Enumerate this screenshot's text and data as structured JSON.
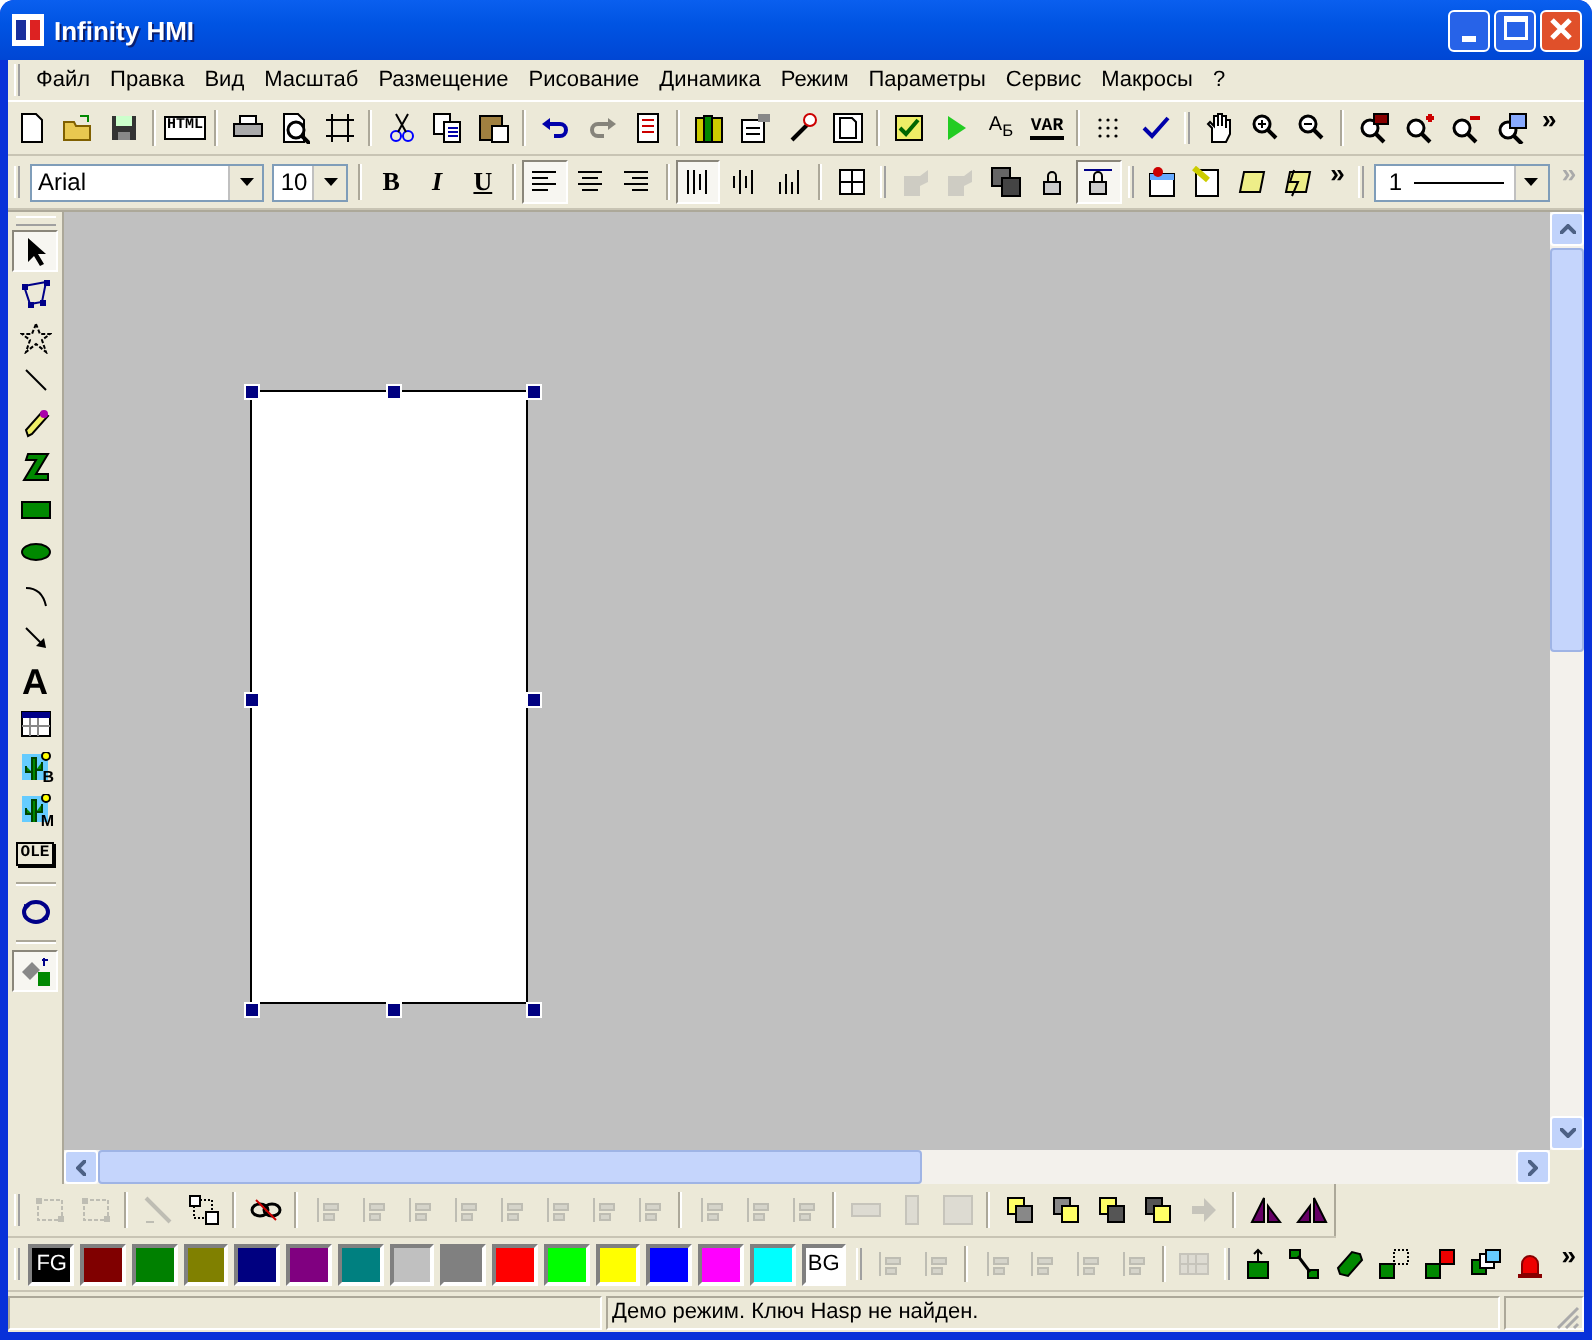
{
  "window": {
    "title": "Infinity HMI"
  },
  "menu": [
    {
      "label": "Файл"
    },
    {
      "label": "Правка"
    },
    {
      "label": "Вид"
    },
    {
      "label": "Масштаб"
    },
    {
      "label": "Размещение"
    },
    {
      "label": "Рисование"
    },
    {
      "label": "Динамика"
    },
    {
      "label": "Режим"
    },
    {
      "label": "Параметры"
    },
    {
      "label": "Сервис"
    },
    {
      "label": "Макросы"
    },
    {
      "label": "?"
    }
  ],
  "toolbar_main": [
    {
      "kind": "button",
      "disabled": false
    },
    {
      "kind": "button",
      "disabled": false
    },
    {
      "kind": "button",
      "disabled": false
    },
    {
      "kind": "separator"
    },
    {
      "kind": "button",
      "disabled": false,
      "label": "HTML"
    },
    {
      "kind": "separator"
    },
    {
      "kind": "button",
      "disabled": false
    },
    {
      "kind": "button",
      "disabled": false
    },
    {
      "kind": "button",
      "disabled": false
    },
    {
      "kind": "separator"
    },
    {
      "kind": "button",
      "disabled": false
    },
    {
      "kind": "button",
      "disabled": false
    },
    {
      "kind": "button",
      "disabled": false
    },
    {
      "kind": "separator"
    },
    {
      "kind": "button",
      "disabled": false
    },
    {
      "kind": "button",
      "disabled": true
    },
    {
      "kind": "button",
      "disabled": false
    },
    {
      "kind": "separator"
    },
    {
      "kind": "button",
      "disabled": false
    },
    {
      "kind": "button",
      "disabled": false
    },
    {
      "kind": "button",
      "disabled": false
    },
    {
      "kind": "button",
      "disabled": false
    },
    {
      "kind": "separator"
    },
    {
      "kind": "button",
      "disabled": false
    },
    {
      "kind": "button",
      "disabled": false
    },
    {
      "kind": "button",
      "disabled": false,
      "label": "A$_{Б}$"
    },
    {
      "kind": "button",
      "disabled": false,
      "label": "VAR"
    },
    {
      "kind": "separator"
    },
    {
      "kind": "button",
      "disabled": false
    },
    {
      "kind": "button",
      "disabled": false
    },
    {
      "kind": "grip"
    },
    {
      "kind": "button",
      "disabled": false
    },
    {
      "kind": "button",
      "disabled": false
    },
    {
      "kind": "button",
      "disabled": false
    },
    {
      "kind": "separator"
    },
    {
      "kind": "button",
      "disabled": false
    },
    {
      "kind": "button",
      "disabled": false
    },
    {
      "kind": "button",
      "disabled": false
    },
    {
      "kind": "button",
      "disabled": false
    },
    {
      "kind": "chevron",
      "label": "»"
    }
  ],
  "toolbar_format": [
    {
      "kind": "combo",
      "value": "Arial"
    },
    {
      "kind": "combo",
      "value": "10"
    },
    {
      "kind": "separator"
    },
    {
      "kind": "button",
      "disabled": false,
      "selected": false,
      "label": "B"
    },
    {
      "kind": "button",
      "disabled": false,
      "selected": false,
      "label": "I"
    },
    {
      "kind": "button",
      "disabled": false,
      "selected": false,
      "label": "U"
    },
    {
      "kind": "separator"
    },
    {
      "kind": "button",
      "disabled": false,
      "selected": true
    },
    {
      "kind": "button",
      "disabled": false,
      "selected": false
    },
    {
      "kind": "button",
      "disabled": false,
      "selected": false
    },
    {
      "kind": "separator"
    },
    {
      "kind": "button",
      "disabled": false,
      "selected": true
    },
    {
      "kind": "button",
      "disabled": false,
      "selected": false
    },
    {
      "kind": "button",
      "disabled": false,
      "selected": false
    },
    {
      "kind": "separator"
    },
    {
      "kind": "button",
      "disabled": false,
      "selected": false
    },
    {
      "kind": "grip"
    },
    {
      "kind": "button",
      "disabled": true,
      "selected": false
    },
    {
      "kind": "button",
      "disabled": true,
      "selected": false
    },
    {
      "kind": "button",
      "disabled": false,
      "selected": false
    },
    {
      "kind": "button",
      "disabled": false,
      "selected": false
    },
    {
      "kind": "button",
      "disabled": false,
      "selected": true
    },
    {
      "kind": "grip"
    },
    {
      "kind": "button",
      "disabled": false,
      "selected": false
    },
    {
      "kind": "button",
      "disabled": false,
      "selected": false
    },
    {
      "kind": "button",
      "disabled": false,
      "selected": false
    },
    {
      "kind": "button",
      "disabled": false,
      "selected": false
    },
    {
      "kind": "chevron",
      "label": "»",
      "disabled": false
    },
    {
      "kind": "grip"
    },
    {
      "kind": "line_combo",
      "value": "1"
    },
    {
      "kind": "chevron",
      "label": "»",
      "disabled": true
    }
  ],
  "toolbox": [
    {
      "kind": "button",
      "selected": true
    },
    {
      "kind": "button",
      "selected": false
    },
    {
      "kind": "button",
      "selected": false
    },
    {
      "kind": "button",
      "selected": false
    },
    {
      "kind": "button",
      "selected": false
    },
    {
      "kind": "button",
      "selected": false
    },
    {
      "kind": "button",
      "selected": false
    },
    {
      "kind": "button",
      "selected": false
    },
    {
      "kind": "button",
      "selected": false
    },
    {
      "kind": "button",
      "selected": false
    },
    {
      "kind": "button",
      "selected": false,
      "label": "A"
    },
    {
      "kind": "button",
      "selected": false
    },
    {
      "kind": "button",
      "selected": false,
      "label": "B"
    },
    {
      "kind": "button",
      "selected": false,
      "label": "M"
    },
    {
      "kind": "button",
      "selected": false,
      "label": "OLE"
    },
    {
      "kind": "separator"
    },
    {
      "kind": "button",
      "selected": false
    },
    {
      "kind": "separator"
    },
    {
      "kind": "button",
      "selected": true
    }
  ],
  "toolbar_arrange": [
    {
      "kind": "button",
      "disabled": true
    },
    {
      "kind": "button",
      "disabled": true
    },
    {
      "kind": "separator"
    },
    {
      "kind": "button",
      "disabled": true
    },
    {
      "kind": "button",
      "disabled": false
    },
    {
      "kind": "separator"
    },
    {
      "kind": "button",
      "disabled": false
    },
    {
      "kind": "separator"
    },
    {
      "kind": "button",
      "disabled": true
    },
    {
      "kind": "button",
      "disabled": true
    },
    {
      "kind": "button",
      "disabled": true
    },
    {
      "kind": "button",
      "disabled": true
    },
    {
      "kind": "button",
      "disabled": true
    },
    {
      "kind": "button",
      "disabled": true
    },
    {
      "kind": "button",
      "disabled": true
    },
    {
      "kind": "button",
      "disabled": true
    },
    {
      "kind": "separator"
    },
    {
      "kind": "button",
      "disabled": true
    },
    {
      "kind": "button",
      "disabled": true
    },
    {
      "kind": "button",
      "disabled": true
    },
    {
      "kind": "separator"
    },
    {
      "kind": "button",
      "disabled": true
    },
    {
      "kind": "button",
      "disabled": true
    },
    {
      "kind": "button",
      "disabled": true
    },
    {
      "kind": "separator"
    },
    {
      "kind": "button",
      "disabled": false
    },
    {
      "kind": "button",
      "disabled": false
    },
    {
      "kind": "button",
      "disabled": false
    },
    {
      "kind": "button",
      "disabled": false
    },
    {
      "kind": "button",
      "disabled": true
    },
    {
      "kind": "separator"
    },
    {
      "kind": "button",
      "disabled": false
    },
    {
      "kind": "button",
      "disabled": false
    }
  ],
  "palette": [
    {
      "label": "FG",
      "color": "#000000"
    },
    {
      "color": "#800000"
    },
    {
      "color": "#008000"
    },
    {
      "color": "#808000"
    },
    {
      "color": "#000080"
    },
    {
      "color": "#800080"
    },
    {
      "color": "#008080"
    },
    {
      "color": "#c0c0c0"
    },
    {
      "color": "#808080"
    },
    {
      "color": "#ff0000"
    },
    {
      "color": "#00ff00"
    },
    {
      "color": "#ffff00"
    },
    {
      "color": "#0000ff"
    },
    {
      "color": "#ff00ff"
    },
    {
      "color": "#00ffff"
    },
    {
      "label": "BG",
      "color": "#ffffff"
    }
  ],
  "toolbar_dynamics": [
    {
      "kind": "grip"
    },
    {
      "kind": "button",
      "disabled": true
    },
    {
      "kind": "button",
      "disabled": true
    },
    {
      "kind": "separator"
    },
    {
      "kind": "button",
      "disabled": true
    },
    {
      "kind": "button",
      "disabled": true
    },
    {
      "kind": "button",
      "disabled": true
    },
    {
      "kind": "button",
      "disabled": true
    },
    {
      "kind": "separator"
    },
    {
      "kind": "button",
      "disabled": true
    },
    {
      "kind": "grip"
    },
    {
      "kind": "button",
      "disabled": false
    },
    {
      "kind": "button",
      "disabled": false
    },
    {
      "kind": "button",
      "disabled": false
    },
    {
      "kind": "button",
      "disabled": false
    },
    {
      "kind": "button",
      "disabled": false
    },
    {
      "kind": "button",
      "disabled": false
    },
    {
      "kind": "button",
      "disabled": false
    },
    {
      "kind": "chevron",
      "label": "»"
    }
  ],
  "status_bar": {
    "message": "Демо режим. Ключ Hasp не найден."
  }
}
